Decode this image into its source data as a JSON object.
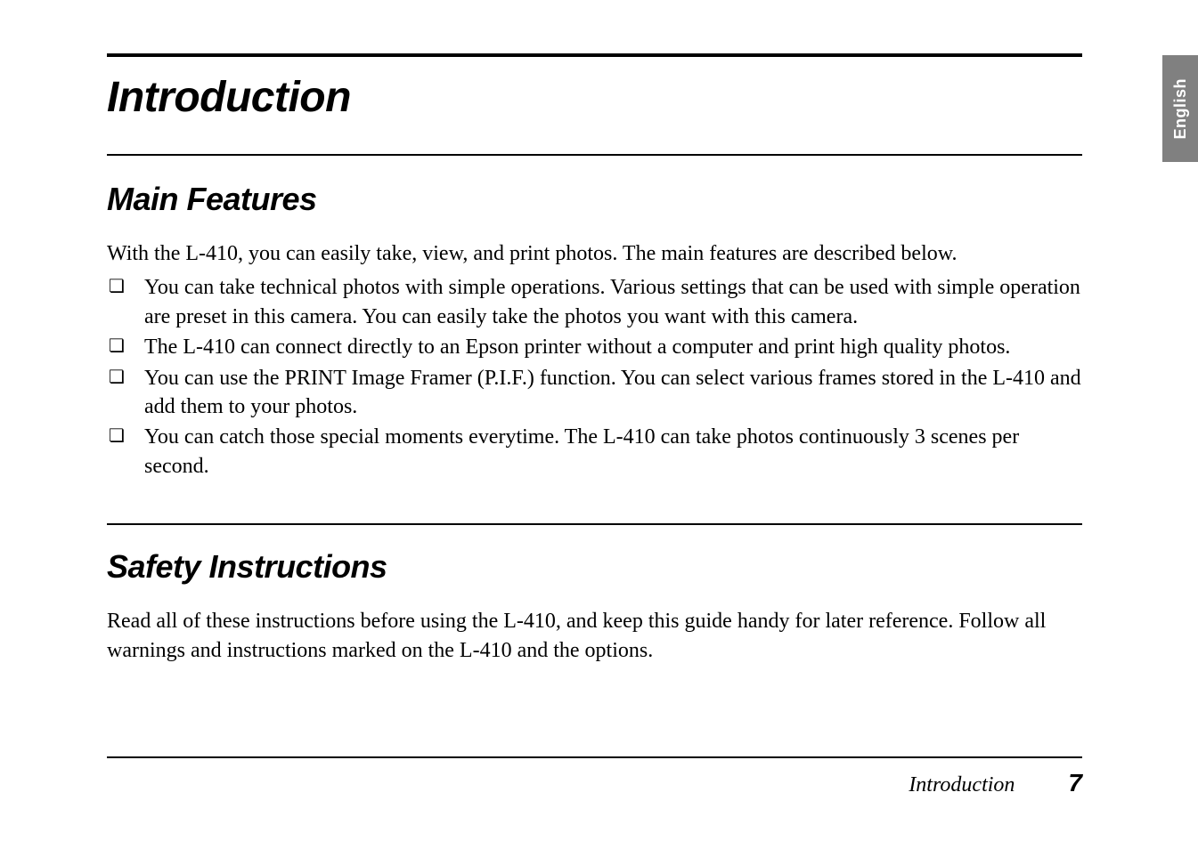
{
  "side_tab": {
    "label": "English"
  },
  "chapter": {
    "title": "Introduction"
  },
  "section_main_features": {
    "heading": "Main Features",
    "intro": "With the L-410, you can easily take, view, and print photos. The main features are described below.",
    "bullets": [
      "You can take technical photos with simple operations. Various settings that can be used with simple operation are preset in this camera. You can easily take the photos you want with this camera.",
      "The L-410 can connect directly to an Epson printer without a computer and print high quality photos.",
      "You can use the PRINT Image Framer (P.I.F.) function. You can select various frames stored in the L-410 and add them to your photos.",
      "You can catch those special moments everytime. The L-410 can take photos continuously 3 scenes per second."
    ]
  },
  "section_safety": {
    "heading": "Safety Instructions",
    "body": "Read all of these instructions before using the L-410, and keep this guide handy for later reference. Follow all warnings and instructions marked on the L-410 and the options."
  },
  "footer": {
    "section_name": "Introduction",
    "page_number": "7"
  }
}
